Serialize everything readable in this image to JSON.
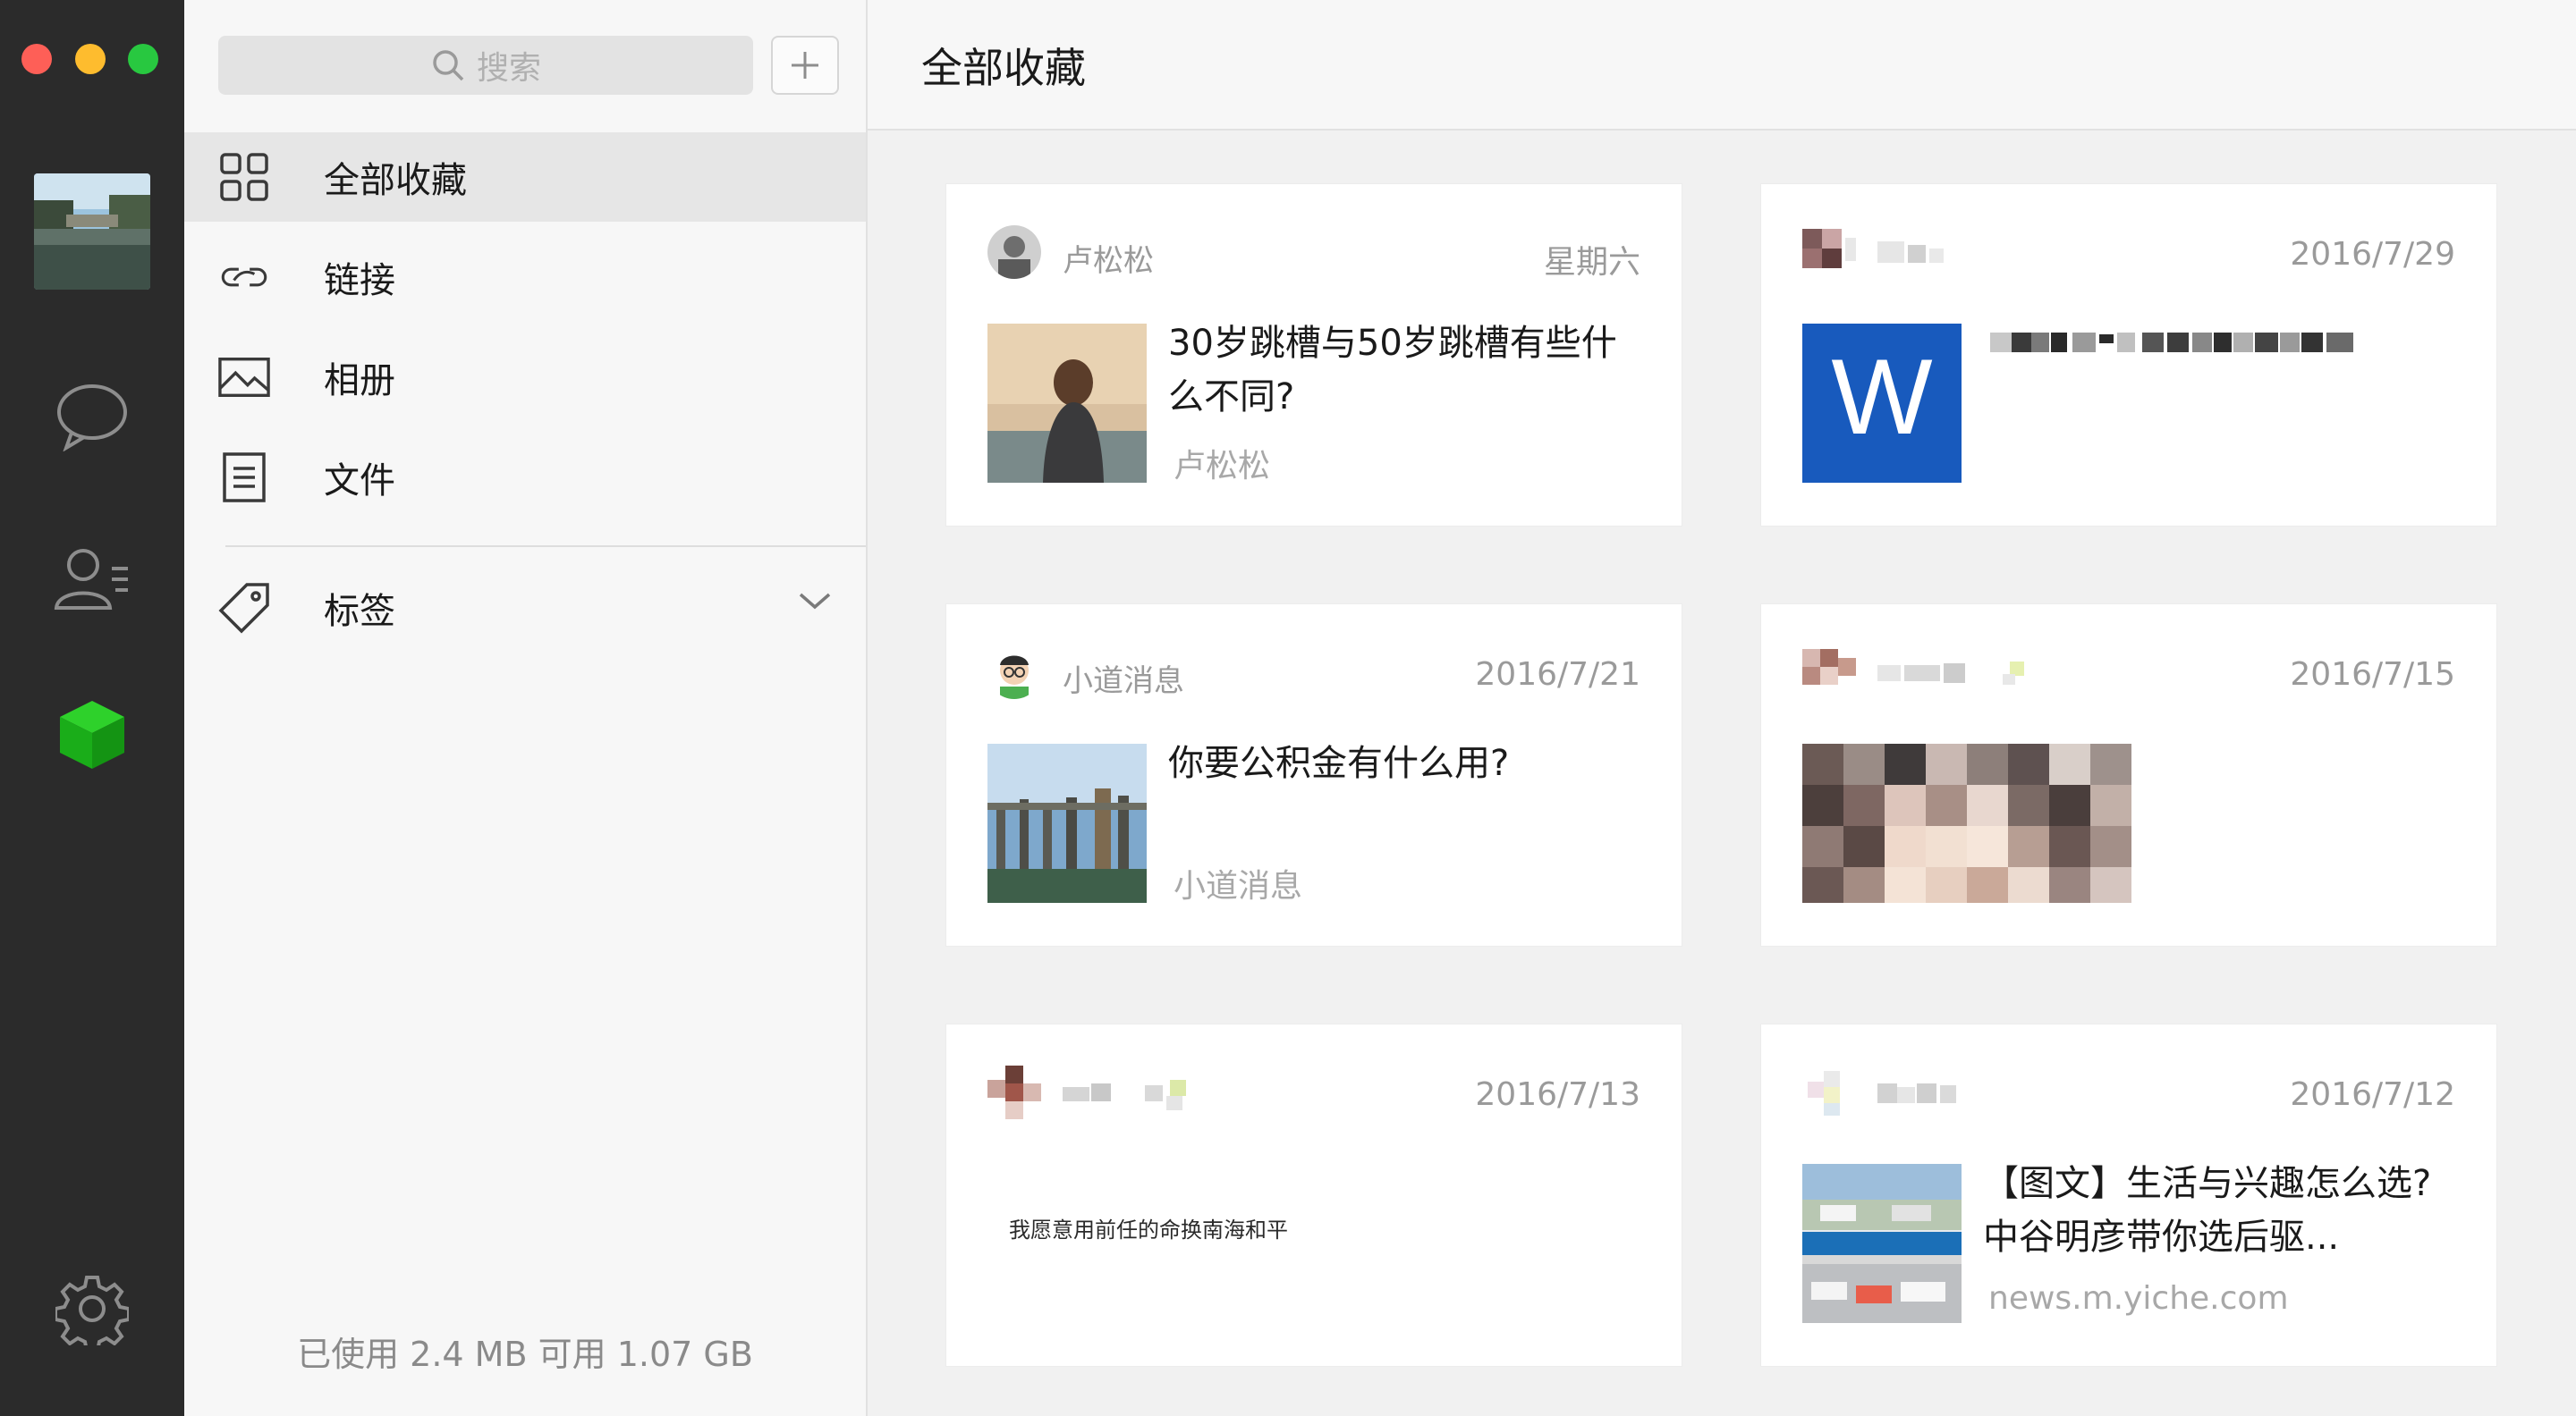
{
  "window": {
    "traffic_lights": {
      "close": "#fe5f57",
      "minimize": "#febc2e",
      "zoom": "#28c840"
    }
  },
  "rail": {
    "icons": [
      "avatar",
      "chat-icon",
      "contacts-icon",
      "favorites-cube-icon",
      "settings-icon"
    ],
    "active_color": "#1aad19"
  },
  "sidebar": {
    "search_placeholder": "搜索",
    "add_label": "+",
    "items": [
      {
        "label": "全部收藏",
        "icon": "grid-icon",
        "active": true
      },
      {
        "label": "链接",
        "icon": "link-icon",
        "active": false
      },
      {
        "label": "相册",
        "icon": "image-icon",
        "active": false
      },
      {
        "label": "文件",
        "icon": "document-icon",
        "active": false
      }
    ],
    "tags_label": "标签",
    "storage_text": "已使用 2.4 MB 可用 1.07 GB"
  },
  "main": {
    "title": "全部收藏",
    "cards": [
      {
        "author": "卢松松",
        "date": "星期六",
        "title": "30岁跳槽与50岁跳槽有些什么不同?",
        "source": "卢松松",
        "kind": "article"
      },
      {
        "author": "",
        "date": "2016/7/29",
        "title": "",
        "source": "",
        "kind": "file-word",
        "file_letter": "W"
      },
      {
        "author": "小道消息",
        "date": "2016/7/21",
        "title": "你要公积金有什么用?",
        "source": "小道消息",
        "kind": "article"
      },
      {
        "author": "",
        "date": "2016/7/15",
        "title": "",
        "source": "",
        "kind": "image"
      },
      {
        "author": "",
        "date": "2016/7/13",
        "title": "",
        "text": "我愿意用前任的命换南海和平",
        "source": "",
        "kind": "text"
      },
      {
        "author": "",
        "date": "2016/7/12",
        "title": "【图文】生活与兴趣怎么选?中谷明彦带你选后驱...",
        "source": "news.m.yiche.com",
        "kind": "article"
      }
    ]
  }
}
